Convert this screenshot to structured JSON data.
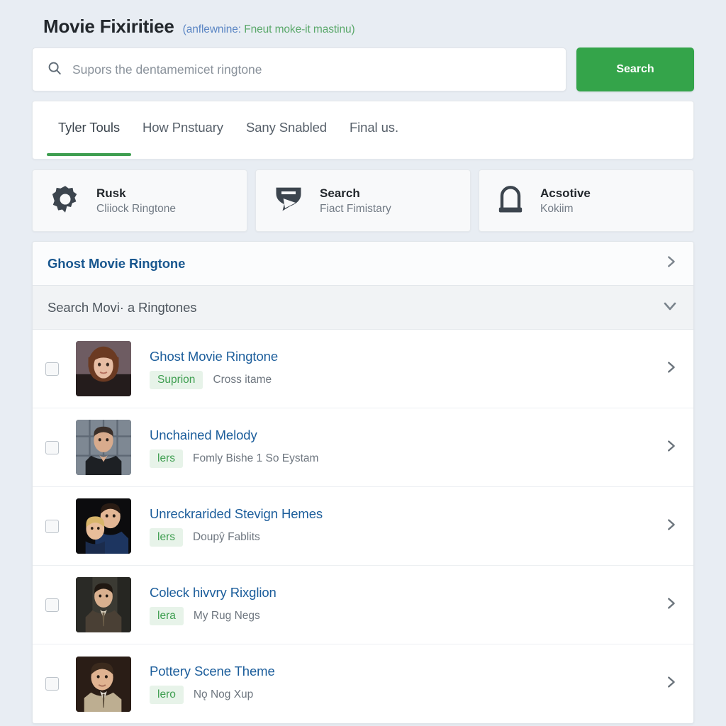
{
  "header": {
    "title": "Movie Fixiritiee",
    "subtitle_blue": "(anflewnine:",
    "subtitle_green": "Fneut moke-it mastinu)"
  },
  "search": {
    "placeholder": "Supors the dentamemicet ringtone",
    "value": "",
    "button_label": "Search",
    "icon": "search-icon",
    "accent_color": "#34a44a"
  },
  "tabs": [
    {
      "label": "Tyler Touls",
      "active": true
    },
    {
      "label": "How Pnstuary",
      "active": false
    },
    {
      "label": "Sany Snabled",
      "active": false
    },
    {
      "label": "Final us.",
      "active": false
    }
  ],
  "features": [
    {
      "title": "Rusk",
      "subtitle": "Cliiock Ringtone",
      "icon": "gear-icon"
    },
    {
      "title": "Search",
      "subtitle": "Fiact Fimistary",
      "icon": "flag-icon"
    },
    {
      "title": "Acsotive",
      "subtitle": "Kokiim",
      "icon": "lock-icon"
    }
  ],
  "panel": {
    "primary_bar": {
      "title": "Ghost Movie Ringtone",
      "icon": "chevron-right-icon"
    },
    "secondary_bar": {
      "title": "Search Movi· a Ringtones",
      "icon": "chevron-down-icon"
    },
    "rows": [
      {
        "title": "Ghost Movie Ringtone",
        "badge": "Suprion",
        "subtitle": "Cross itame",
        "checked": false,
        "thumb": {
          "bg": "#6e5c62",
          "skin": "#e7bda4",
          "hair": "#6b3a22",
          "cloth": "#241c1c"
        }
      },
      {
        "title": "Unchained Melody",
        "badge": "lers",
        "subtitle": "Fomly Bishe 1 So Eystam",
        "checked": false,
        "thumb": {
          "bg": "#7e8893",
          "skin": "#d8ab8d",
          "hair": "#3a2e28",
          "cloth": "#1d2024"
        }
      },
      {
        "title": "Unreckrarided Stevign Hemes",
        "badge": "lers",
        "subtitle": "Doupŷ Fablits",
        "checked": false,
        "thumb": {
          "bg": "#0c0c0e",
          "skin": "#e3b795",
          "hair": "#2a1c14",
          "cloth": "#1d3560"
        }
      },
      {
        "title": "Coleck hivvry Rixglion",
        "badge": "lera",
        "subtitle": "My Rug Negs",
        "checked": false,
        "thumb": {
          "bg": "#3b3a33",
          "skin": "#d9b08f",
          "hair": "#201812",
          "cloth": "#4a4035"
        }
      },
      {
        "title": "Pottery Scene Theme",
        "badge": "lero",
        "subtitle": "Nǫ Nog Xup",
        "checked": false,
        "thumb": {
          "bg": "#2a1d16",
          "skin": "#e0b391",
          "hair": "#3b2a1d",
          "cloth": "#bdae91"
        }
      }
    ]
  }
}
